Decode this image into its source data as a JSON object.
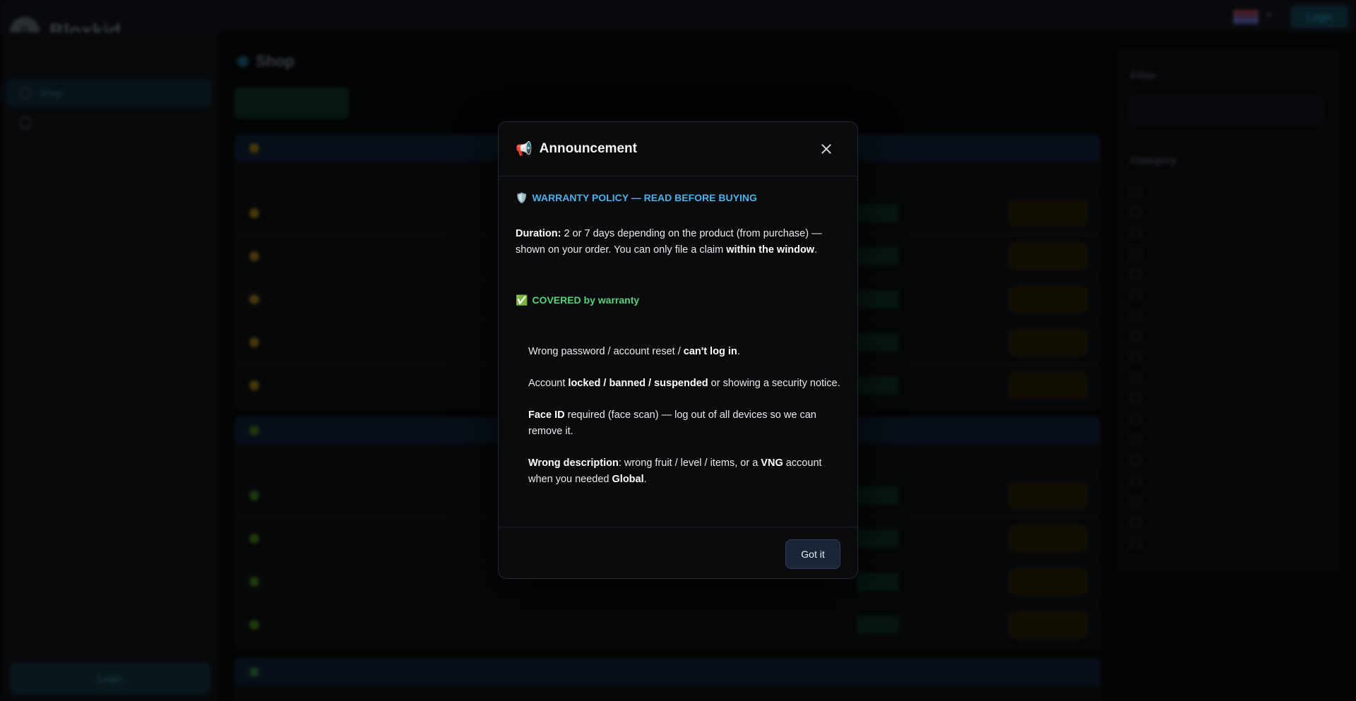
{
  "app": {
    "brand_name": "Bloxkid",
    "brand_sub": "",
    "top_note": "",
    "login_label": "Login",
    "page_title": "Shop",
    "sort_label": "",
    "tab_label": "",
    "sidebar": {
      "items": [
        {
          "label": "Shop"
        },
        {
          "label": ""
        }
      ],
      "login_label": "Login"
    },
    "sections": [
      {
        "title": "",
        "dot_color": "#5a4a10",
        "rows": 5
      },
      {
        "title": "",
        "dot_color": "#2b4a14",
        "rows": 4
      },
      {
        "title": "",
        "dot_color": "#1d4a2a",
        "rows": 0
      }
    ],
    "filter": {
      "title": "Filter",
      "search_placeholder": "",
      "category_title": "Category",
      "category_count": 18
    }
  },
  "modal": {
    "title_icon": "📢",
    "title": "Announcement",
    "warranty_icon": "🛡️",
    "warranty_heading": "WARRANTY POLICY — READ BEFORE BUYING",
    "duration_label": "Duration:",
    "duration_text_1": " 2 or 7 days depending on the product (from purchase) — shown on your order. You can only file a claim ",
    "duration_bold": "within the window",
    "duration_text_2": ".",
    "covered_icon": "✅",
    "covered_heading": "COVERED by warranty",
    "bullet1_text": "Wrong password / account reset / ",
    "bullet1_bold": "can't log in",
    "bullet1_end": ".",
    "bullet2_text": "Account ",
    "bullet2_bold": "locked / banned / suspended",
    "bullet2_end": " or showing a security notice.",
    "bullet3_bold": "Face ID",
    "bullet3_text": " required (face scan) — log out of all devices so we can remove it.",
    "bullet4_bold1": "Wrong description",
    "bullet4_text1": ": wrong fruit / level / items, or a ",
    "bullet4_bold2": "VNG",
    "bullet4_text2": " account when you needed ",
    "bullet4_bold3": "Global",
    "bullet4_end": ".",
    "confirm_label": "Got it"
  }
}
